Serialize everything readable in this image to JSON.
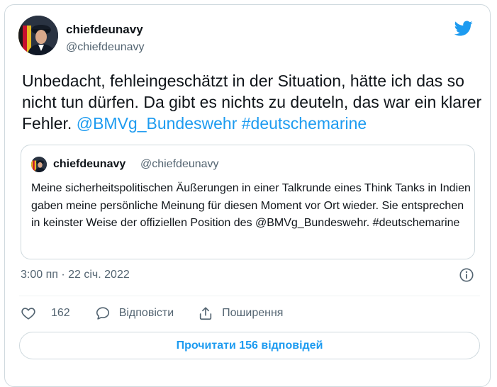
{
  "author": {
    "name": "chiefdeunavy",
    "handle": "@chiefdeunavy"
  },
  "tweet": {
    "text": "Unbedacht, fehleingeschätzt in der Situation, hätte ich das so nicht tun dürfen. Da gibt es nichts zu deuteln, das war ein klarer Fehler.",
    "mention": "@BMVg_Bundeswehr",
    "hashtag": "#deutschemarine"
  },
  "quoted": {
    "name": "chiefdeunavy",
    "handle": "@chiefdeunavy",
    "text": "Meine sicherheitspolitischen Äußerungen in einer Talkrunde eines Think Tanks in Indien gaben meine persönliche Meinung für diesen Moment vor Ort wieder. Sie entsprechen in keinster Weise der offiziellen Position des @BMVg_Bundeswehr. #deutschemarine"
  },
  "timestamp": "3:00 пп · 22 січ. 2022",
  "actions": {
    "like_count": "162",
    "reply_label": "Відповісти",
    "share_label": "Поширення"
  },
  "read_replies_label": "Прочитати 156 відповідей",
  "colors": {
    "accent": "#1d9bf0",
    "text": "#0f1419",
    "secondary": "#536471",
    "border": "#cfd9de"
  },
  "icons": [
    "twitter-bird-icon",
    "info-icon",
    "heart-icon",
    "reply-bubble-icon",
    "share-icon"
  ]
}
